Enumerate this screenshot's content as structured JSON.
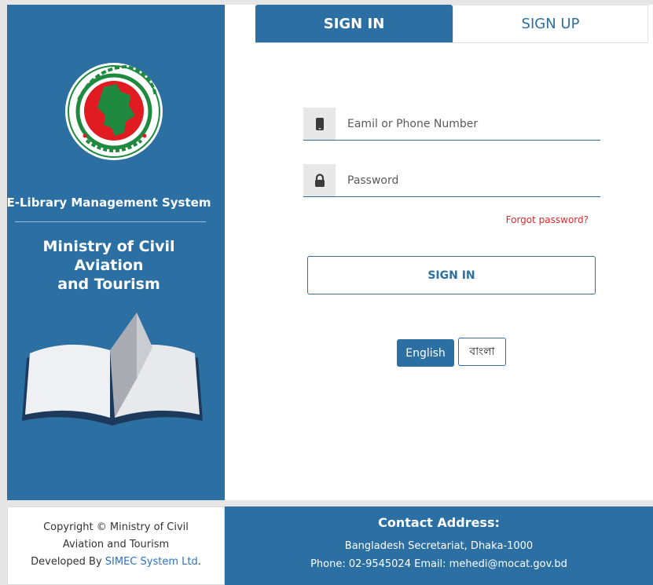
{
  "sidebar": {
    "emblem_icon": "bangladesh-government-emblem",
    "system_title": "E-Library Management System",
    "ministry_line1": "Ministry of Civil Aviation",
    "ministry_line2": "and Tourism",
    "book_icon": "open-book"
  },
  "tabs": {
    "signin": "SIGN IN",
    "signup": "SIGN UP"
  },
  "form": {
    "email_placeholder": "Eamil or Phone Number",
    "password_placeholder": "Password",
    "forgot": "Forgot password?",
    "submit": "SIGN IN"
  },
  "language": {
    "english": "English",
    "bangla": "বাংলা"
  },
  "footer": {
    "copyright_line1": "Copyright © Ministry of Civil",
    "copyright_line2": "Aviation and Tourism",
    "developed_by": "Developed By ",
    "company": "SIMEC System Ltd",
    "period": ".",
    "contact_title": "Contact Address:",
    "address": "Bangladesh Secretariat, Dhaka-1000",
    "phone_email": "Phone: 02-9545024 Email: mehedi@mocat.gov.bd"
  },
  "colors": {
    "primary": "#2c6fa3",
    "danger": "#e5262a",
    "link": "#2a73c4",
    "emblem_green": "#1f8a3f",
    "emblem_red": "#e11b22"
  }
}
